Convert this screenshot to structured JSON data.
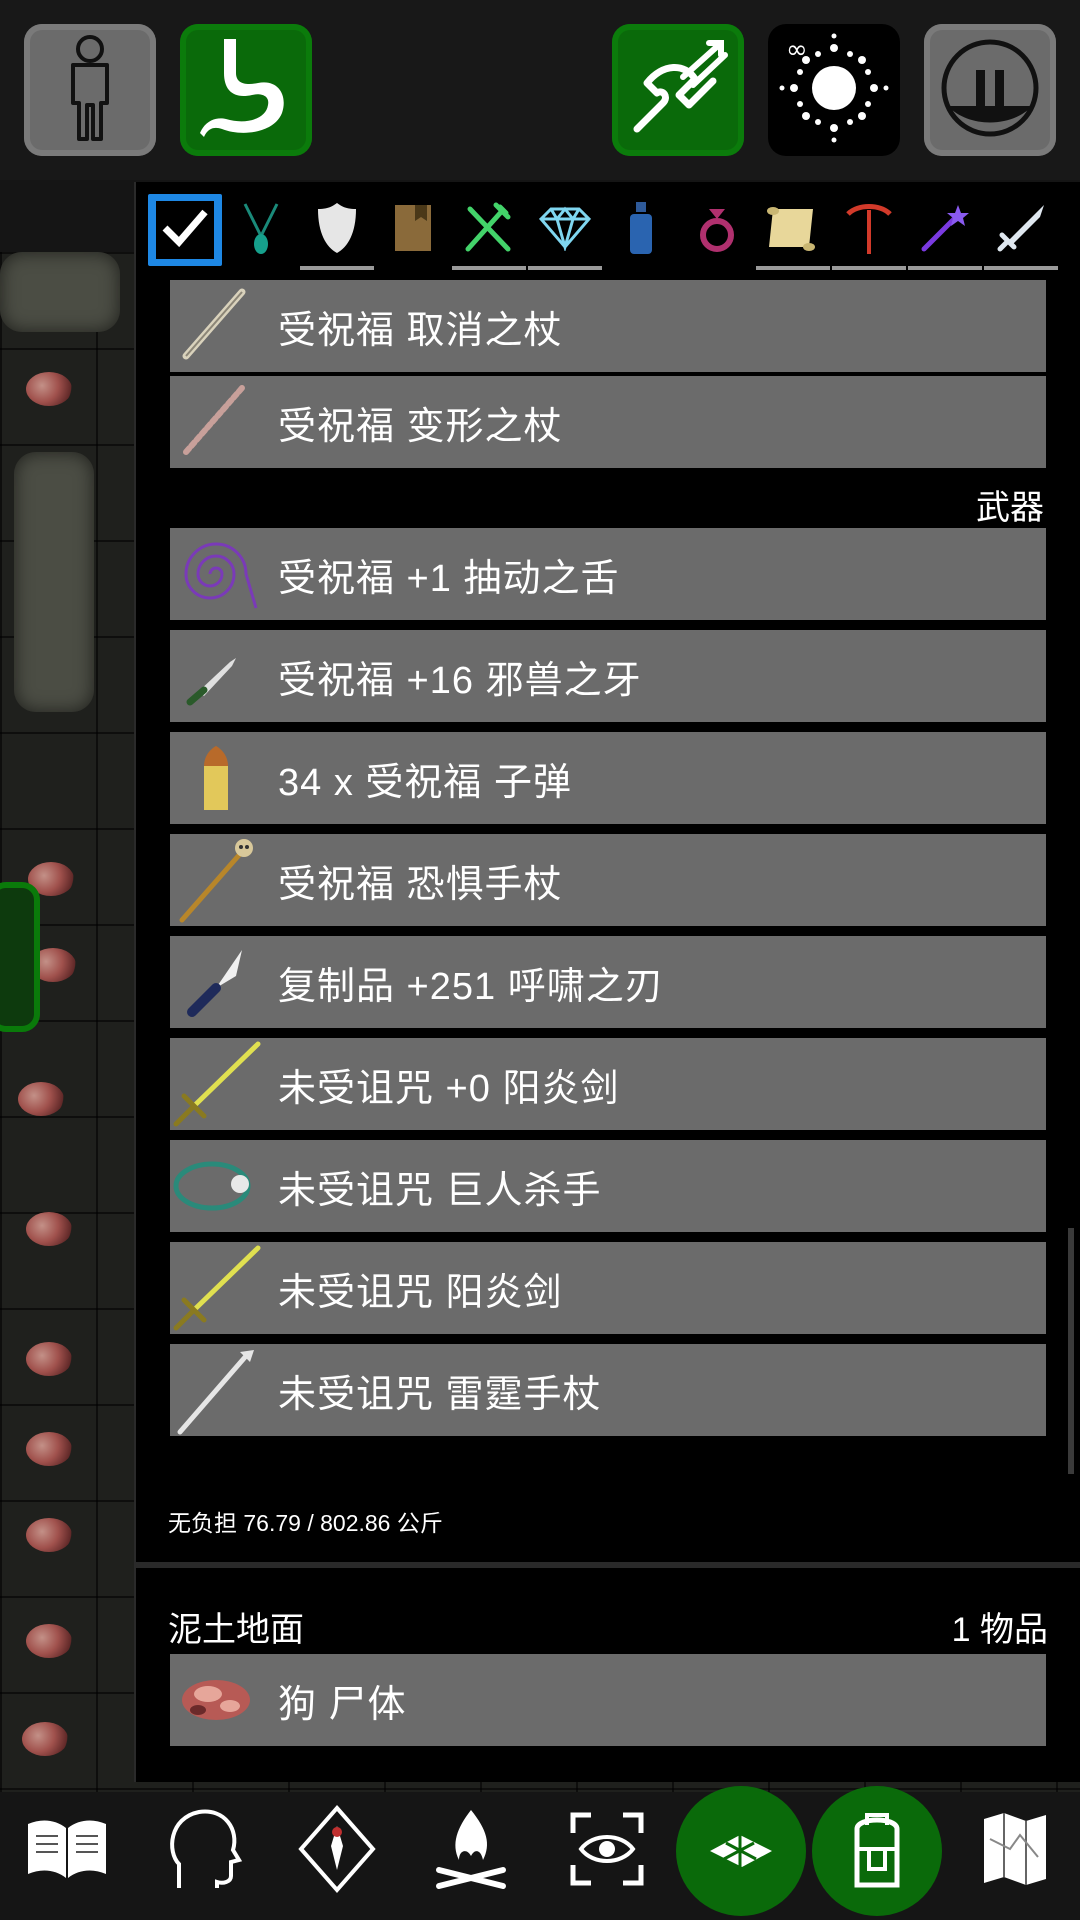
{
  "top_bar": {
    "icons": [
      "person-icon",
      "stomach-icon",
      "quiver-icon",
      "infinity-spell-icon",
      "pause-icon"
    ]
  },
  "filter_tabs": [
    {
      "icon": "check-icon",
      "active": true
    },
    {
      "icon": "amulet-icon"
    },
    {
      "icon": "shield-icon"
    },
    {
      "icon": "book-icon"
    },
    {
      "icon": "fork-knife-icon"
    },
    {
      "icon": "gem-icon"
    },
    {
      "icon": "potion-icon"
    },
    {
      "icon": "ring-icon"
    },
    {
      "icon": "scroll-icon"
    },
    {
      "icon": "pickaxe-icon"
    },
    {
      "icon": "wand-icon"
    },
    {
      "icon": "sword-icon"
    }
  ],
  "inventory": {
    "wands": [
      {
        "label": "受祝福 取消之杖",
        "icon": "wand-bone-icon"
      },
      {
        "label": "受祝福 变形之杖",
        "icon": "wand-twisted-icon"
      }
    ],
    "weapons_header": "武器",
    "weapons": [
      {
        "label": "受祝福 +1 抽动之舌",
        "icon": "whip-icon"
      },
      {
        "label": "受祝福 +16 邪兽之牙",
        "icon": "dagger-icon"
      },
      {
        "label": "34 x 受祝福 子弹",
        "icon": "bullet-icon"
      },
      {
        "label": "受祝福 恐惧手杖",
        "icon": "skull-staff-icon"
      },
      {
        "label": "复制品 +251 呼啸之刃",
        "icon": "knife-icon"
      },
      {
        "label": "未受诅咒 +0 阳炎剑",
        "icon": "golden-sword-icon"
      },
      {
        "label": "未受诅咒 巨人杀手",
        "icon": "sling-icon"
      },
      {
        "label": "未受诅咒 阳炎剑",
        "icon": "golden-sword-icon"
      },
      {
        "label": "未受诅咒 雷霆手杖",
        "icon": "white-staff-icon"
      }
    ],
    "weight": "无负担 76.79 / 802.86 公斤"
  },
  "floor": {
    "name": "泥土地面",
    "count": "1 物品",
    "items": [
      {
        "label": "狗 尸体",
        "icon": "corpse-icon"
      }
    ]
  },
  "bottom_bar": {
    "icons": [
      "book-icon",
      "head-icon",
      "compass-icon",
      "campfire-icon",
      "look-icon",
      "floor-tiles-icon",
      "backpack-icon",
      "map-icon"
    ]
  },
  "colors": {
    "accent_green": "#0a6a0a",
    "active_blue": "#1e88e5",
    "item_bg": "#6b6b6b",
    "panel_bg": "#000000"
  }
}
